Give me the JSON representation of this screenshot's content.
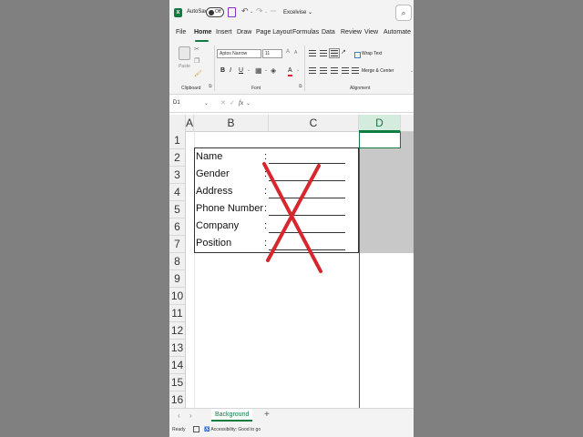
{
  "titlebar": {
    "autosave_label": "AutoSave",
    "autosave_state": "Off",
    "undo_glyph": "↶",
    "redo_glyph": "↷",
    "filename": "Excelvise",
    "filename_caret": "⌄",
    "search_glyph": "⌕"
  },
  "tabs": [
    "File",
    "Home",
    "Insert",
    "Draw",
    "Page Layout",
    "Formulas",
    "Data",
    "Review",
    "View",
    "Automate"
  ],
  "active_tab": "Home",
  "ribbon": {
    "clipboard_label": "Clipboard",
    "paste_label": "Paste",
    "font_name": "Aptos Narrow",
    "font_size": "11",
    "font_label": "Font",
    "alignment_label": "Alignment",
    "wrap_text": "Wrap Text",
    "merge_center": "Merge & Center",
    "bold": "B",
    "italic": "I",
    "underline": "U",
    "font_color": "A"
  },
  "formula_bar": {
    "name_box": "D1",
    "fx": "fx"
  },
  "columns": [
    "A",
    "B",
    "C",
    "D"
  ],
  "active_column": "D",
  "rows": [
    "1",
    "2",
    "3",
    "4",
    "5",
    "6",
    "7",
    "8",
    "9",
    "10",
    "11",
    "12",
    "13",
    "14",
    "15",
    "16"
  ],
  "form": {
    "fields": [
      "Name",
      "Gender",
      "Address",
      "Phone Number",
      "Company",
      "Position"
    ],
    "colon": ":"
  },
  "sheets": {
    "active": "Background",
    "nav_prev": "‹",
    "nav_next": "›",
    "add": "+"
  },
  "status": {
    "ready": "Ready",
    "accessibility": "Accessibility: Good to go"
  },
  "colors": {
    "excel_green": "#107c41",
    "cross_red": "#d7262e",
    "accent_purple": "#8b2fc9"
  }
}
